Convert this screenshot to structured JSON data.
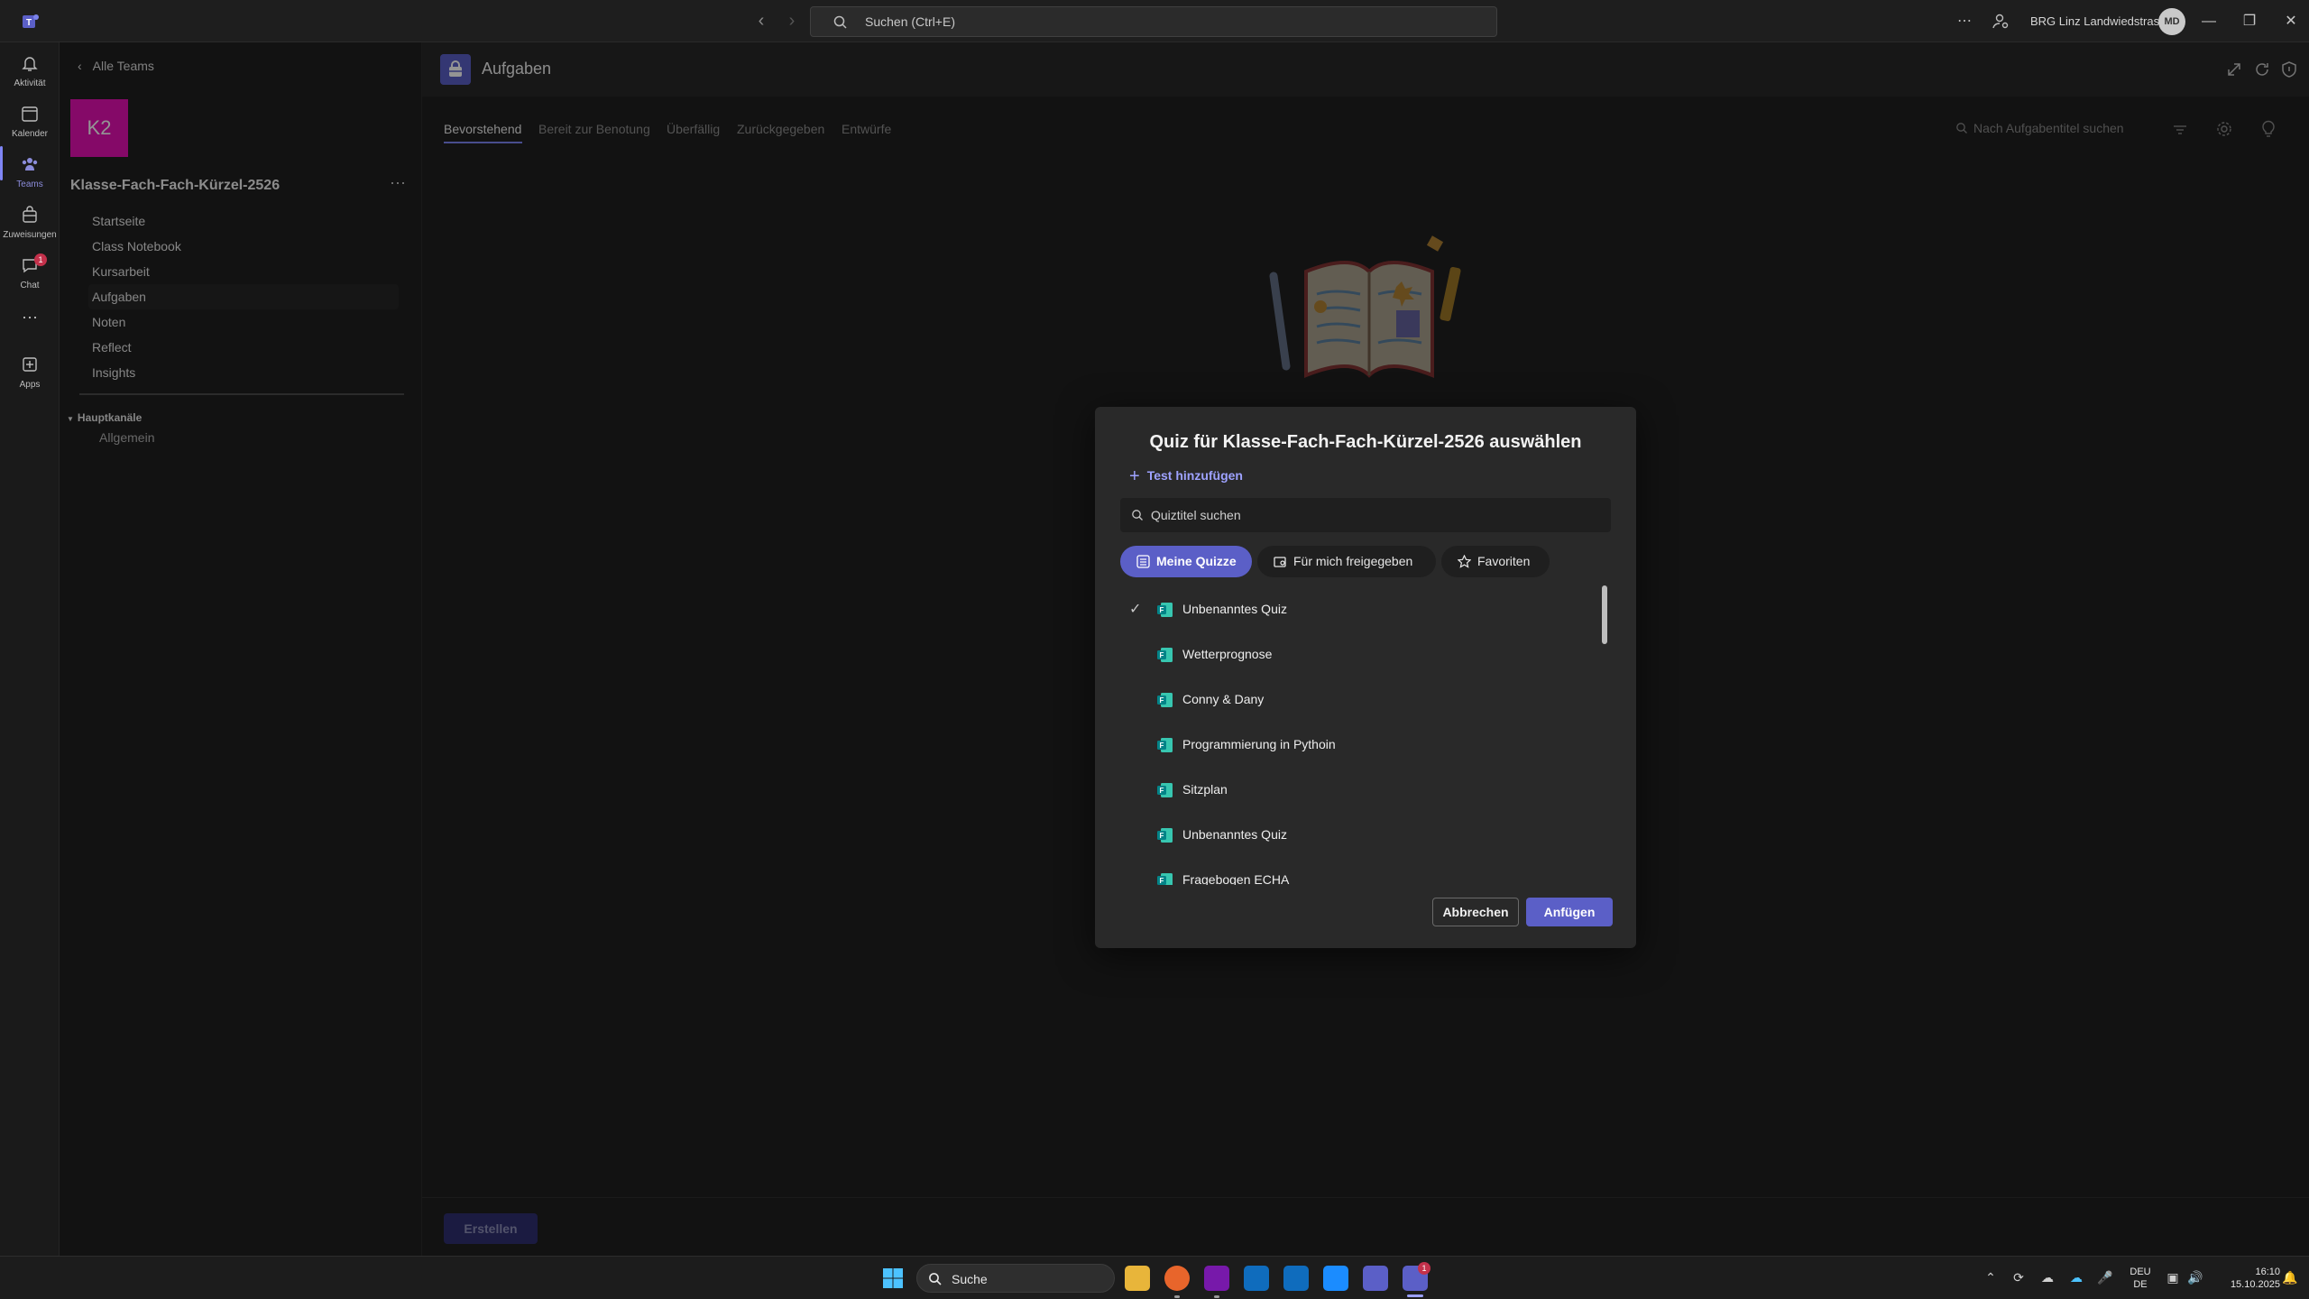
{
  "titlebar": {
    "search_placeholder": "Suchen (Ctrl+E)",
    "org_name": "BRG Linz Landwiedstrasse",
    "avatar_initials": "MD"
  },
  "rail": {
    "items": [
      {
        "label": "Aktivität",
        "icon": "bell-icon"
      },
      {
        "label": "Kalender",
        "icon": "calendar-icon"
      },
      {
        "label": "Teams",
        "icon": "teams-icon"
      },
      {
        "label": "Zuweisungen",
        "icon": "assignments-icon"
      },
      {
        "label": "Chat",
        "icon": "chat-icon",
        "badge": "1"
      },
      {
        "label": "Apps",
        "icon": "apps-icon"
      }
    ]
  },
  "sidebar": {
    "back_label": "Alle Teams",
    "team_initials": "K2",
    "team_name": "Klasse-Fach-Fach-Kürzel-2526",
    "nav": [
      "Startseite",
      "Class Notebook",
      "Kursarbeit",
      "Aufgaben",
      "Noten",
      "Reflect",
      "Insights"
    ],
    "channels_header": "Hauptkanäle",
    "channels": [
      "Allgemein"
    ]
  },
  "main": {
    "app_title": "Aufgaben",
    "tabs": [
      "Bevorstehend",
      "Bereit zur Benotung",
      "Überfällig",
      "Zurückgegeben",
      "Entwürfe"
    ],
    "task_search_placeholder": "Nach Aufgabentitel suchen",
    "create_label": "Erstellen"
  },
  "dialog": {
    "title": "Quiz für Klasse-Fach-Fach-Kürzel-2526 auswählen",
    "add_test_label": "Test hinzufügen",
    "search_placeholder": "Quiztitel suchen",
    "filters": [
      "Meine Quizze",
      "Für mich freigegeben",
      "Favoriten"
    ],
    "quizzes": [
      {
        "name": "Unbenanntes Quiz",
        "selected": true
      },
      {
        "name": "Wetterprognose",
        "selected": false
      },
      {
        "name": "Conny & Dany",
        "selected": false
      },
      {
        "name": "Programmierung in Pythoin",
        "selected": false
      },
      {
        "name": "Sitzplan",
        "selected": false
      },
      {
        "name": "Unbenanntes Quiz",
        "selected": false
      },
      {
        "name": "Fragebogen ECHA",
        "selected": false
      }
    ],
    "cancel_label": "Abbrechen",
    "attach_label": "Anfügen"
  },
  "taskbar": {
    "search_label": "Suche",
    "teams_badge": "1",
    "lang_top": "DEU",
    "lang_bottom": "DE",
    "time": "16:10",
    "date": "15.10.2025"
  },
  "colors": {
    "accent": "#5b5fc7",
    "accent_light": "#7f85f5",
    "team_tile": "#e510b3",
    "badge": "#c4314b"
  }
}
